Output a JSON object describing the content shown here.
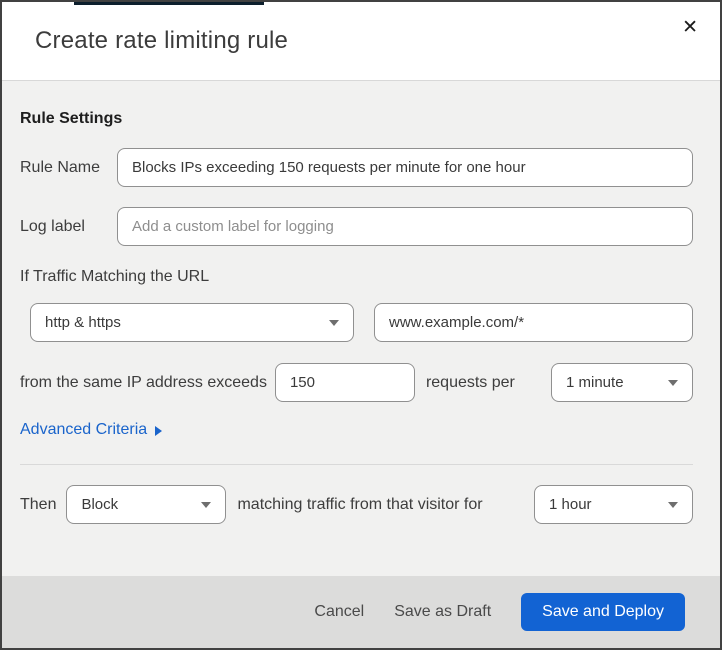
{
  "colors": {
    "primary_button_blue": "#1263d3",
    "link_blue": "#1a64cb",
    "body_gray": "#f1f1f0",
    "footer_gray": "#dcdcdb",
    "top_strip_navy": "#0d1f2d"
  },
  "modal": {
    "title": "Create rate limiting rule",
    "close_glyph": "✕"
  },
  "body": {
    "section_heading": "Rule Settings",
    "rule_name": {
      "label": "Rule Name",
      "value": "Blocks IPs exceeding 150 requests per minute for one hour"
    },
    "log_label": {
      "label": "Log label",
      "placeholder": "Add a custom label for logging"
    },
    "traffic_heading": "If Traffic Matching the URL",
    "scheme_select": {
      "value": "http & https"
    },
    "url_input": {
      "value": "www.example.com/*"
    },
    "threshold": {
      "prefix": "from the same IP address exceeds",
      "requests_value": "150",
      "connector": "requests per",
      "period_value": "1 minute"
    },
    "advanced_link": "Advanced Criteria",
    "then": {
      "label": "Then",
      "action_value": "Block",
      "connector": "matching traffic from that visitor for",
      "duration_value": "1 hour"
    }
  },
  "footer": {
    "cancel_label": "Cancel",
    "save_draft_label": "Save as Draft",
    "save_deploy_label": "Save and Deploy"
  }
}
